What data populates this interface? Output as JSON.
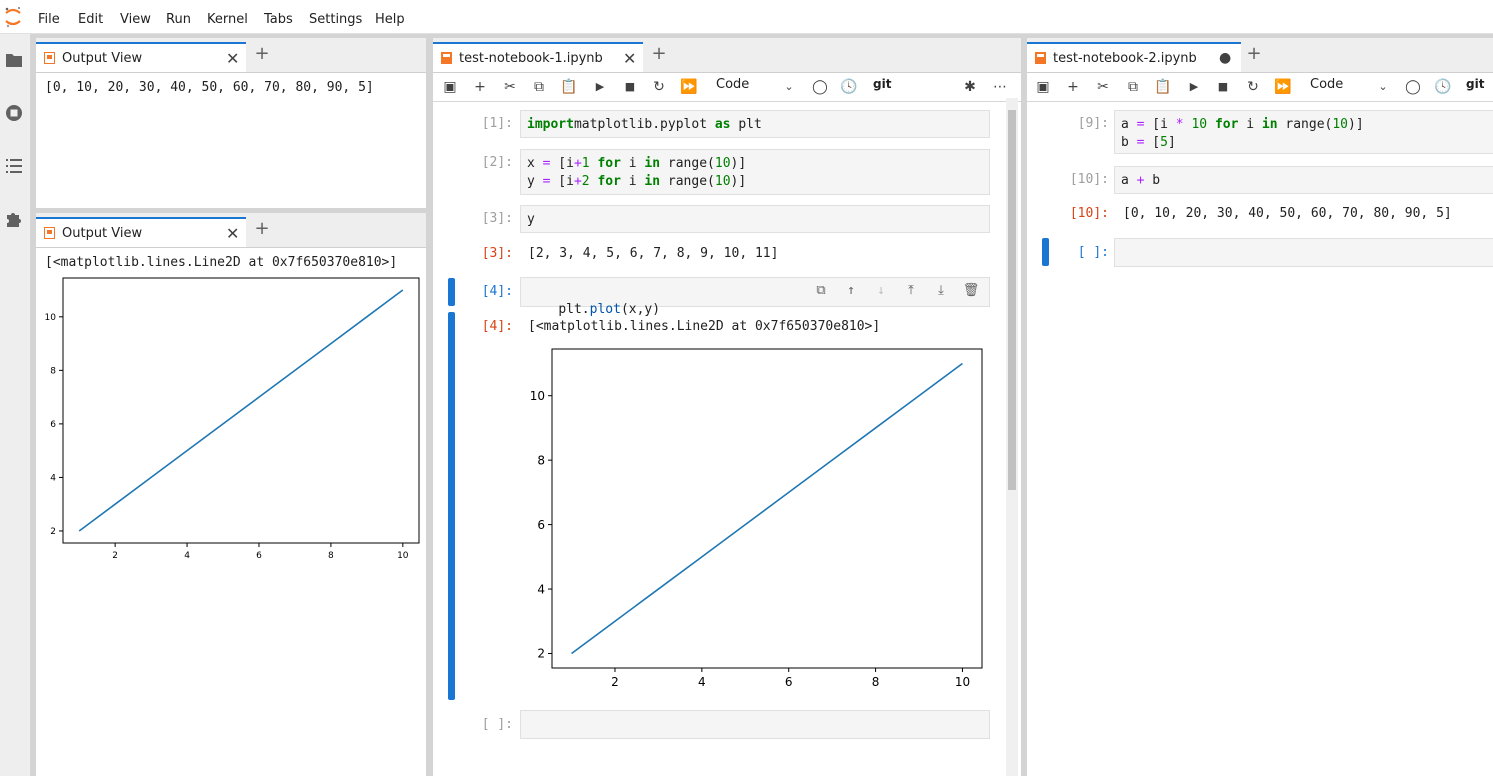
{
  "menu": [
    "File",
    "Edit",
    "View",
    "Run",
    "Kernel",
    "Tabs",
    "Settings",
    "Help"
  ],
  "activity_icons": [
    "folder-icon",
    "running-icon",
    "toc-icon",
    "extension-icon"
  ],
  "output_view_1": {
    "tab_label": "Output View",
    "text": "[0, 10, 20, 30, 40, 50, 60, 70, 80, 90, 5]"
  },
  "output_view_2": {
    "tab_label": "Output View",
    "text": "[<matplotlib.lines.Line2D at 0x7f650370e810>]"
  },
  "notebook1": {
    "tab_label": "test-notebook-1.ipynb",
    "cell_type": "Code",
    "git_label": "git",
    "cells": [
      {
        "prompt": "[1]:",
        "code_parts": [
          [
            "kw",
            "import"
          ],
          [
            "",
            "matplotlib.pyplot "
          ],
          [
            "kw",
            "as"
          ],
          [
            "",
            " plt"
          ]
        ]
      },
      {
        "prompt": "[2]:",
        "line1": [
          [
            "",
            "x "
          ],
          [
            "op",
            "="
          ],
          [
            "",
            " [i"
          ],
          [
            "op",
            "+"
          ],
          [
            "num",
            "1"
          ],
          [
            "",
            " "
          ],
          [
            "kw",
            "for"
          ],
          [
            "",
            " i "
          ],
          [
            "kw",
            "in"
          ],
          [
            "",
            " range("
          ],
          [
            "num",
            "10"
          ],
          [
            "",
            ")]"
          ]
        ],
        "line2": [
          [
            "",
            "y "
          ],
          [
            "op",
            "="
          ],
          [
            "",
            " [i"
          ],
          [
            "op",
            "+"
          ],
          [
            "num",
            "2"
          ],
          [
            "",
            " "
          ],
          [
            "kw",
            "for"
          ],
          [
            "",
            " i "
          ],
          [
            "kw",
            "in"
          ],
          [
            "",
            " range("
          ],
          [
            "num",
            "10"
          ],
          [
            "",
            ")]"
          ]
        ]
      },
      {
        "prompt": "[3]:",
        "code": "y",
        "out_prompt": "[3]:",
        "output": "[2, 3, 4, 5, 6, 7, 8, 9, 10, 11]"
      },
      {
        "prompt": "[4]:",
        "code_parts": [
          [
            "",
            "plt."
          ],
          [
            "fn",
            "plot"
          ],
          [
            "",
            "(x,y)"
          ]
        ],
        "out_prompt": "[4]:",
        "output": "[<matplotlib.lines.Line2D at 0x7f650370e810>]"
      },
      {
        "prompt": "[ ]:"
      }
    ]
  },
  "notebook2": {
    "tab_label": "test-notebook-2.ipynb",
    "cell_type": "Code",
    "git_label": "git",
    "cells": [
      {
        "prompt": "[9]:",
        "line1": [
          [
            "",
            "a "
          ],
          [
            "op",
            "="
          ],
          [
            "",
            " [i "
          ],
          [
            "op",
            "*"
          ],
          [
            "",
            " "
          ],
          [
            "num",
            "10"
          ],
          [
            "",
            " "
          ],
          [
            "kw",
            "for"
          ],
          [
            "",
            " i "
          ],
          [
            "kw",
            "in"
          ],
          [
            "",
            " range("
          ],
          [
            "num",
            "10"
          ],
          [
            "",
            ")]"
          ]
        ],
        "line2": [
          [
            "",
            "b "
          ],
          [
            "op",
            "="
          ],
          [
            "",
            " ["
          ],
          [
            "num",
            "5"
          ],
          [
            "",
            "]"
          ]
        ]
      },
      {
        "prompt": "[10]:",
        "code_parts": [
          [
            "",
            "a "
          ],
          [
            "op",
            "+"
          ],
          [
            "",
            " b"
          ]
        ],
        "out_prompt": "[10]:",
        "output": "[0, 10, 20, 30, 40, 50, 60, 70, 80, 90, 5]"
      },
      {
        "prompt": "[ ]:"
      }
    ]
  },
  "chart_data": [
    {
      "type": "line",
      "x": [
        1,
        2,
        3,
        4,
        5,
        6,
        7,
        8,
        9,
        10
      ],
      "series": [
        {
          "values": [
            2,
            3,
            4,
            5,
            6,
            7,
            8,
            9,
            10,
            11
          ],
          "color": "#1f77b4"
        }
      ],
      "xticks": [
        2,
        4,
        6,
        8,
        10
      ],
      "yticks": [
        2,
        4,
        6,
        8,
        10
      ],
      "xlim": [
        0.55,
        10.45
      ],
      "ylim": [
        1.55,
        11.45
      ],
      "grid": false
    }
  ],
  "colors": {
    "accent": "#1976d2",
    "line": "#1f77b4",
    "out_prompt": "#d84315"
  }
}
